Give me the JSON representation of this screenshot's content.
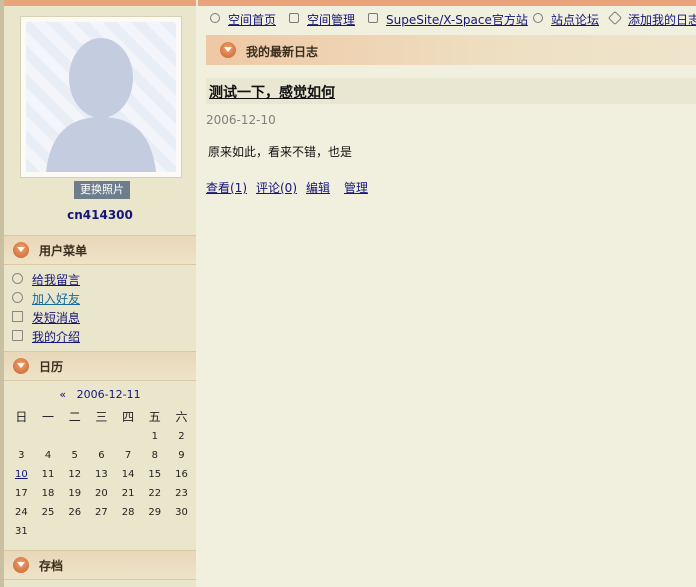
{
  "sidebar": {
    "change_photo": "更换照片",
    "username": "cn414300",
    "user_menu_title": "用户菜单",
    "menu": [
      {
        "label": "给我留言",
        "icon": "speech-bubble-icon"
      },
      {
        "label": "加入好友",
        "icon": "add-friend-icon"
      },
      {
        "label": "发短消息",
        "icon": "envelope-icon"
      },
      {
        "label": "我的介绍",
        "icon": "id-card-icon"
      }
    ],
    "calendar_title": "日历",
    "archive_title": "存档"
  },
  "calendar": {
    "prev": "«",
    "date": "2006-12-11",
    "weekdays": [
      "日",
      "一",
      "二",
      "三",
      "四",
      "五",
      "六"
    ],
    "weeks": [
      [
        "",
        "",
        "",
        "",
        "",
        "1",
        "2"
      ],
      [
        "3",
        "4",
        "5",
        "6",
        "7",
        "8",
        "9"
      ],
      [
        "10",
        "11",
        "12",
        "13",
        "14",
        "15",
        "16"
      ],
      [
        "17",
        "18",
        "19",
        "20",
        "21",
        "22",
        "23"
      ],
      [
        "24",
        "25",
        "26",
        "27",
        "28",
        "29",
        "30"
      ],
      [
        "31",
        "",
        "",
        "",
        "",
        "",
        ""
      ]
    ],
    "linked_day": "10"
  },
  "nav": [
    {
      "label": "空间首页",
      "icon": "person-icon"
    },
    {
      "label": "空间管理",
      "icon": "tools-icon"
    },
    {
      "label": "SupeSite/X-Space官方站",
      "icon": "home-icon"
    },
    {
      "label": "站点论坛",
      "icon": "forum-bubble-icon"
    },
    {
      "label": "添加我的日志",
      "icon": "pencil-icon"
    }
  ],
  "main": {
    "section_title": "我的最新日志",
    "post": {
      "title": "测试一下，感觉如何",
      "date": "2006-12-10",
      "body": "原来如此，看来不错，也是",
      "actions": [
        "查看(1)",
        "评论(0)",
        "编辑",
        "管理"
      ]
    }
  },
  "colors": {
    "accent": "#e8a57c",
    "link": "#15157a",
    "background": "#f1efdd"
  }
}
